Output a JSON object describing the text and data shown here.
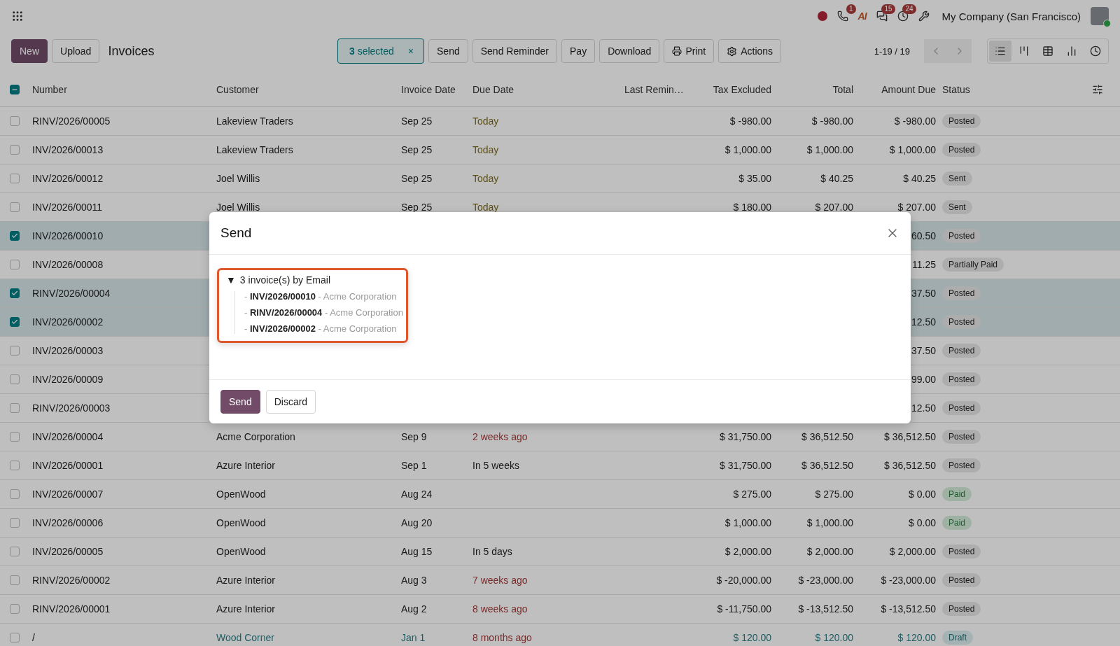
{
  "topbar": {
    "phone_badge": "1",
    "ai_label": "AI",
    "chat_badge": "15",
    "activity_badge": "24",
    "company": "My Company (San Francisco)"
  },
  "control_bar": {
    "buttons": [
      {
        "label": "New",
        "kind": "primary"
      },
      {
        "label": "Upload",
        "kind": "secondary"
      }
    ],
    "title": "Invoices",
    "selection": "**3** selected",
    "clear": "×",
    "actions": [
      {
        "label": "Send",
        "kind": "text"
      },
      {
        "label": "Send Reminder",
        "kind": "text"
      },
      {
        "label": "Pay",
        "kind": "text"
      },
      {
        "label": "Download",
        "kind": "text"
      },
      {
        "label": "Print",
        "kind": "print"
      },
      {
        "label": "Actions",
        "kind": "menu"
      }
    ],
    "pager": "1-19 / 19",
    "views": [
      {
        "kind": "list",
        "selected": true
      },
      {
        "kind": "kanban",
        "selected": false
      },
      {
        "kind": "pivot",
        "selected": false
      },
      {
        "kind": "graph",
        "selected": false
      },
      {
        "kind": "activity",
        "selected": false
      }
    ]
  },
  "table": {
    "partially_selected": true,
    "columns": [
      "Number",
      "Customer",
      "Invoice Date",
      "Due Date",
      "Last Remin…",
      "Tax Excluded",
      "Total",
      "Amount Due",
      "Status"
    ],
    "rows": [
      {
        "selected": false,
        "number": "RINV/2026/00005",
        "customer": "Lakeview Traders",
        "invoice_date": "Sep 25",
        "due_date": "Today",
        "due_today": true,
        "overdue": false,
        "tax_excluded": "$ -980.00",
        "total": "$ -980.00",
        "amount_due": "$ -980.00",
        "status": {
          "label": "Posted",
          "kind": "posted"
        }
      },
      {
        "selected": false,
        "number": "INV/2026/00013",
        "customer": "Lakeview Traders",
        "invoice_date": "Sep 25",
        "due_date": "Today",
        "due_today": true,
        "overdue": false,
        "tax_excluded": "$ 1,000.00",
        "total": "$ 1,000.00",
        "amount_due": "$ 1,000.00",
        "status": {
          "label": "Posted",
          "kind": "posted"
        }
      },
      {
        "selected": false,
        "number": "INV/2026/00012",
        "customer": "Joel Willis",
        "invoice_date": "Sep 25",
        "due_date": "Today",
        "due_today": true,
        "overdue": false,
        "tax_excluded": "$ 35.00",
        "total": "$ 40.25",
        "amount_due": "$ 40.25",
        "status": {
          "label": "Sent",
          "kind": "posted"
        }
      },
      {
        "selected": false,
        "number": "INV/2026/00011",
        "customer": "Joel Willis",
        "invoice_date": "Sep 25",
        "due_date": "Today",
        "due_today": true,
        "overdue": false,
        "tax_excluded": "$ 180.00",
        "total": "$ 207.00",
        "amount_due": "$ 207.00",
        "status": {
          "label": "Sent",
          "kind": "posted"
        }
      },
      {
        "selected": true,
        "number": "INV/2026/00010",
        "amount_due": "60.50",
        "status": {
          "label": "Posted",
          "kind": "posted"
        }
      },
      {
        "selected": false,
        "number": "INV/2026/00008",
        "amount_due": "11.25",
        "status": {
          "label": "Partially Paid",
          "kind": "posted"
        }
      },
      {
        "selected": true,
        "number": "RINV/2026/00004",
        "amount_due": "37.50",
        "status": {
          "label": "Posted",
          "kind": "posted"
        }
      },
      {
        "selected": true,
        "number": "INV/2026/00002",
        "amount_due": "12.50",
        "status": {
          "label": "Posted",
          "kind": "posted"
        }
      },
      {
        "selected": false,
        "number": "INV/2026/00003",
        "amount_due": "37.50",
        "status": {
          "label": "Posted",
          "kind": "posted"
        }
      },
      {
        "selected": false,
        "number": "INV/2026/00009",
        "amount_due": "99.00",
        "status": {
          "label": "Posted",
          "kind": "posted"
        }
      },
      {
        "selected": false,
        "number": "RINV/2026/00003",
        "amount_due": "12.50",
        "status": {
          "label": "Posted",
          "kind": "posted"
        }
      },
      {
        "selected": false,
        "number": "INV/2026/00004",
        "customer": "Acme Corporation",
        "invoice_date": "Sep 9",
        "due_date": "2 weeks ago",
        "overdue": true,
        "tax_excluded": "$ 31,750.00",
        "total": "$ 36,512.50",
        "amount_due": "$ 36,512.50",
        "status": {
          "label": "Posted",
          "kind": "posted"
        }
      },
      {
        "selected": false,
        "number": "INV/2026/00001",
        "customer": "Azure Interior",
        "invoice_date": "Sep 1",
        "due_date": "In 5 weeks",
        "due_today": false,
        "overdue": false,
        "tax_excluded": "$ 31,750.00",
        "total": "$ 36,512.50",
        "amount_due": "$ 36,512.50",
        "status": {
          "label": "Posted",
          "kind": "posted"
        }
      },
      {
        "selected": false,
        "number": "INV/2026/00007",
        "customer": "OpenWood",
        "invoice_date": "Aug 24",
        "tax_excluded": "$ 275.00",
        "total": "$ 275.00",
        "amount_due": "$ 0.00",
        "status": {
          "label": "Paid",
          "kind": "paid"
        }
      },
      {
        "selected": false,
        "number": "INV/2026/00006",
        "customer": "OpenWood",
        "invoice_date": "Aug 20",
        "tax_excluded": "$ 1,000.00",
        "total": "$ 1,000.00",
        "amount_due": "$ 0.00",
        "status": {
          "label": "Paid",
          "kind": "paid"
        }
      },
      {
        "selected": false,
        "number": "INV/2026/00005",
        "customer": "OpenWood",
        "invoice_date": "Aug 15",
        "due_date": "In 5 days",
        "due_today": false,
        "overdue": false,
        "tax_excluded": "$ 2,000.00",
        "total": "$ 2,000.00",
        "amount_due": "$ 2,000.00",
        "status": {
          "label": "Posted",
          "kind": "posted"
        }
      },
      {
        "selected": false,
        "number": "RINV/2026/00002",
        "customer": "Azure Interior",
        "invoice_date": "Aug 3",
        "due_date": "7 weeks ago",
        "overdue": true,
        "tax_excluded": "$ -20,000.00",
        "total": "$ -23,000.00",
        "amount_due": "$ -23,000.00",
        "status": {
          "label": "Posted",
          "kind": "posted"
        }
      },
      {
        "selected": false,
        "number": "RINV/2026/00001",
        "customer": "Azure Interior",
        "invoice_date": "Aug 2",
        "due_date": "8 weeks ago",
        "overdue": true,
        "tax_excluded": "$ -11,750.00",
        "total": "$ -13,512.50",
        "amount_due": "$ -13,512.50",
        "status": {
          "label": "Posted",
          "kind": "posted"
        }
      },
      {
        "selected": false,
        "number": "/",
        "customer": "Wood Corner",
        "invoice_date": "Jan 1",
        "due_date": "8 months ago",
        "overdue": true,
        "tax_excluded": "$ 120.00",
        "total": "$ 120.00",
        "amount_due": "$ 120.00",
        "status": {
          "label": "Draft",
          "kind": "draft"
        }
      }
    ]
  },
  "dialog": {
    "title": "Send",
    "group": {
      "toggle": "▼",
      "expanded": true,
      "label": "3 invoice(s) by Email",
      "items": [
        {
          "prefix": "-",
          "number": "INV/2026/00010",
          "suffix": "- Acme Corporation"
        },
        {
          "prefix": "-",
          "number": "RINV/2026/00004",
          "suffix": "- Acme Corporation"
        },
        {
          "prefix": "-",
          "number": "INV/2026/00002",
          "suffix": "- Acme Corporation"
        }
      ]
    },
    "buttons": [
      {
        "label": "Send",
        "kind": "primary"
      },
      {
        "label": "Discard",
        "kind": "secondary"
      }
    ]
  }
}
